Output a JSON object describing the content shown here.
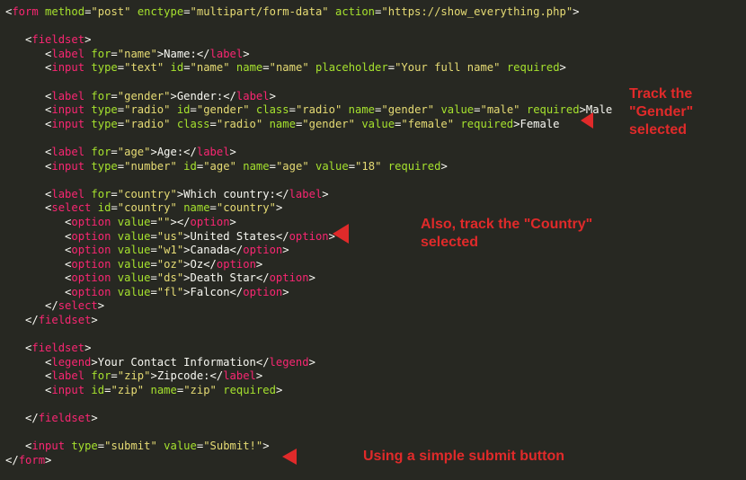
{
  "code": {
    "form_open": {
      "method": "post",
      "enctype": "multipart/form-data",
      "action": "https://show_everything.php"
    },
    "fieldset1": {
      "label_name": {
        "for": "name",
        "text": "Name:"
      },
      "input_name": {
        "type": "text",
        "id": "name",
        "name": "name",
        "placeholder": "Your full name",
        "required": "required"
      },
      "label_gender": {
        "for": "gender",
        "text": "Gender:"
      },
      "radio_male": {
        "type": "radio",
        "id": "gender",
        "class": "radio",
        "name": "gender",
        "value": "male",
        "required": "required",
        "tail": "Male"
      },
      "radio_female": {
        "type": "radio",
        "class": "radio",
        "name": "gender",
        "value": "female",
        "required": "required",
        "tail": "Female"
      },
      "label_age": {
        "for": "age",
        "text": "Age:"
      },
      "input_age": {
        "type": "number",
        "id": "age",
        "name": "age",
        "value": "18",
        "required": "required"
      },
      "label_country": {
        "for": "country",
        "text": "Which country:"
      },
      "select_country": {
        "id": "country",
        "name": "country"
      },
      "options": [
        {
          "value": "",
          "text": ""
        },
        {
          "value": "us",
          "text": "United States"
        },
        {
          "value": "w1",
          "text": "Canada"
        },
        {
          "value": "oz",
          "text": "Oz"
        },
        {
          "value": "ds",
          "text": "Death Star"
        },
        {
          "value": "fl",
          "text": "Falcon"
        }
      ]
    },
    "fieldset2": {
      "legend": "Your Contact Information",
      "label_zip": {
        "for": "zip",
        "text": "Zipcode:"
      },
      "input_zip": {
        "id": "zip",
        "name": "zip",
        "required": "required"
      }
    },
    "submit": {
      "type": "submit",
      "value": "Submit!"
    }
  },
  "annotations": {
    "a1": "Track the\n\"Gender\"\nselected",
    "a2": "Also, track the \"Country\"\nselected",
    "a3": "Using a simple submit button"
  }
}
